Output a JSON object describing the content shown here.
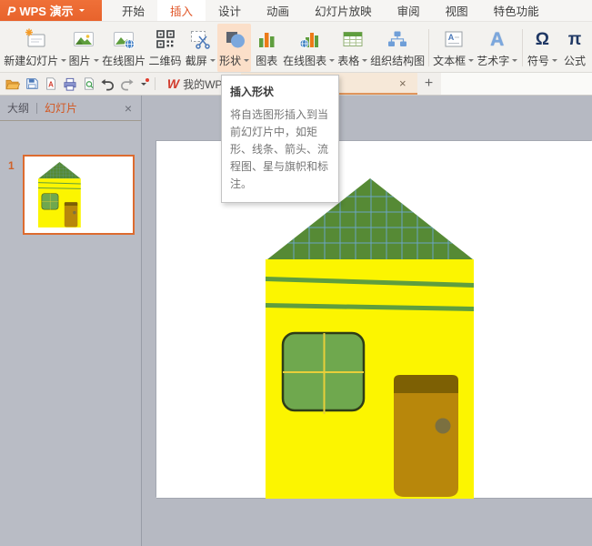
{
  "app": {
    "logo_text": "WPS 演示",
    "logo_glyph": "P"
  },
  "menubar": {
    "tabs": [
      {
        "label": "开始",
        "active": false
      },
      {
        "label": "插入",
        "active": true
      },
      {
        "label": "设计",
        "active": false
      },
      {
        "label": "动画",
        "active": false
      },
      {
        "label": "幻灯片放映",
        "active": false
      },
      {
        "label": "审阅",
        "active": false
      },
      {
        "label": "视图",
        "active": false
      },
      {
        "label": "特色功能",
        "active": false
      }
    ]
  },
  "ribbon": {
    "items": [
      {
        "label": "新建幻灯片",
        "caret": true
      },
      {
        "label": "图片",
        "caret": true
      },
      {
        "label": "在线图片",
        "caret": false
      },
      {
        "label": "二维码",
        "caret": false
      },
      {
        "label": "截屏",
        "caret": true
      },
      {
        "label": "形状",
        "caret": true,
        "highlighted": true
      },
      {
        "label": "图表",
        "caret": false
      },
      {
        "label": "在线图表",
        "caret": true
      },
      {
        "label": "表格",
        "caret": true
      },
      {
        "label": "组织结构图",
        "caret": false
      },
      {
        "label": "文本框",
        "caret": true
      },
      {
        "label": "艺术字",
        "caret": true
      },
      {
        "label": "符号",
        "caret": true
      },
      {
        "label": "公式",
        "caret": false
      }
    ],
    "glyphs": {
      "omega": "Ω",
      "pi": "π",
      "wordart": "A",
      "textbox": "A"
    }
  },
  "quick_access": {
    "my_wps": "我的WPS",
    "glyphs": {
      "wps": "W",
      "pdf": "A"
    }
  },
  "tab_bar": {
    "close": "×",
    "new_tab": "+"
  },
  "tooltip": {
    "title": "插入形状",
    "body": "将自选图形插入到当前幻灯片中，如矩形、线条、箭头、流程图、星与旗帜和标注。"
  },
  "sidebar": {
    "outline_label": "大纲",
    "slides_label": "幻灯片",
    "close": "×",
    "slide_number": "1"
  },
  "colors": {
    "accent": "#e8632c",
    "active-tab-text": "#e1582a",
    "tab-underline": "#e0955c",
    "thumb-border": "#dd6b2f",
    "roof": "#568a35",
    "grid": "#6fa8dc",
    "wall": "#fcf500",
    "stripe": "#5f9e3e",
    "window-green": "#6fa84e",
    "window-outline": "#2f3d17",
    "cross": "#e7cf3a",
    "door-body": "#b8870b",
    "door-band": "#7d6004",
    "knob": "#7b7040"
  }
}
